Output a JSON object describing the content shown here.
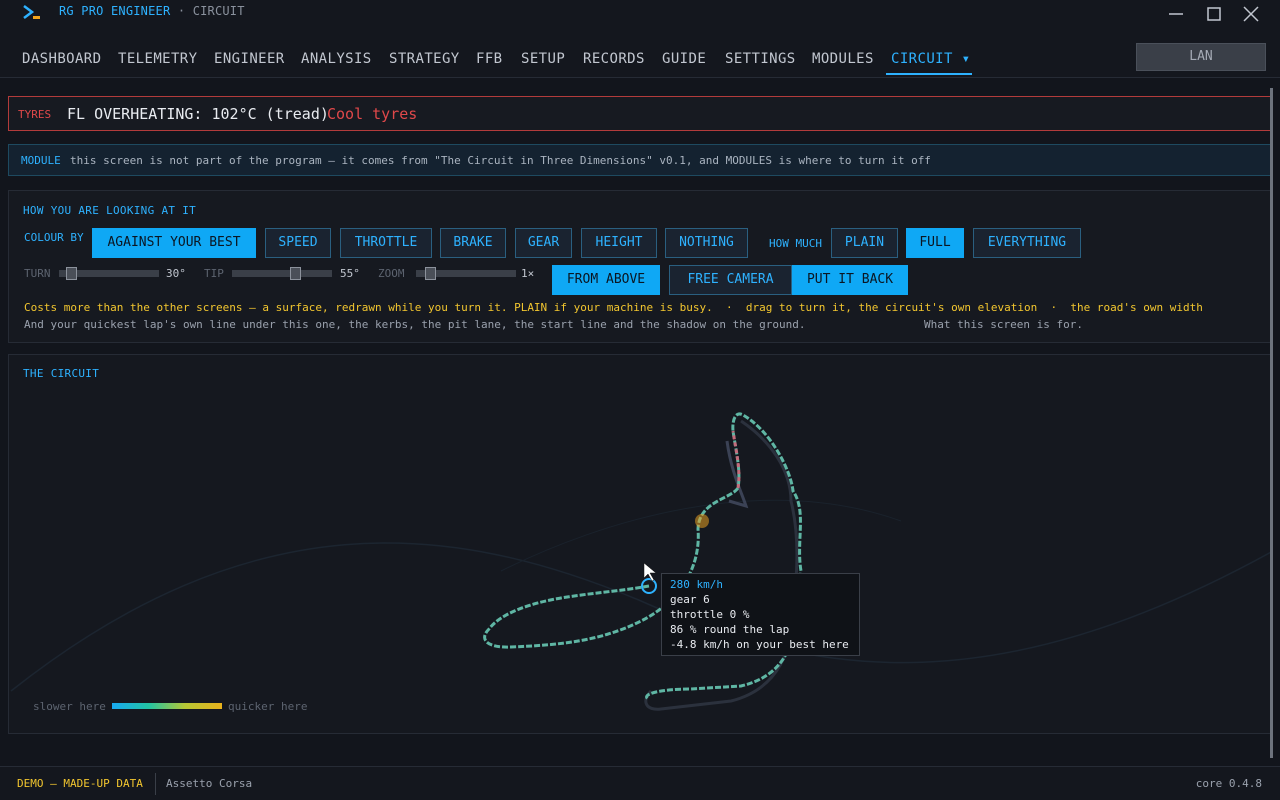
{
  "window": {
    "app_name": "RG PRO ENGINEER",
    "separator": "·",
    "screen_name": "CIRCUIT",
    "logo_icon": "terminal-prompt-icon",
    "accent": "#2eb2ff"
  },
  "nav": {
    "tabs": [
      "DASHBOARD",
      "TELEMETRY",
      "ENGINEER",
      "ANALYSIS",
      "STRATEGY",
      "FFB",
      "SETUP",
      "RECORDS",
      "GUIDE",
      "SETTINGS",
      "MODULES",
      "CIRCUIT ▾"
    ],
    "active": "CIRCUIT ▾",
    "lan_label": "LAN"
  },
  "alert": {
    "tag": "TYRES",
    "message": "FL OVERHEATING: 102°C (tread)",
    "action": "Cool tyres",
    "color": "#e0484a"
  },
  "module_banner": {
    "tag": "MODULE",
    "message": "this screen is not part of the program — it comes from \"The Circuit in Three Dimensions\" v0.1, and MODULES is where to turn it off"
  },
  "controls": {
    "title": "HOW YOU ARE LOOKING AT IT",
    "colour_by_label": "COLOUR BY",
    "colour_by": [
      "AGAINST YOUR BEST",
      "SPEED",
      "THROTTLE",
      "BRAKE",
      "GEAR",
      "HEIGHT",
      "NOTHING"
    ],
    "colour_by_selected": "AGAINST YOUR BEST",
    "how_much_label": "HOW MUCH",
    "how_much": [
      "PLAIN",
      "FULL",
      "EVERYTHING"
    ],
    "how_much_selected": "FULL",
    "turn": {
      "label": "TURN",
      "value": "30°"
    },
    "tip": {
      "label": "TIP",
      "value": "55°"
    },
    "zoom": {
      "label": "ZOOM",
      "value": "1×"
    },
    "from_above": "FROM ABOVE",
    "free_camera": "FREE CAMERA",
    "put_it_back": "PUT IT BACK",
    "note_cost": "Costs more than the other screens — a surface, redrawn while you turn it. PLAIN if your machine is busy.",
    "note_sep": "·",
    "note_drag": "drag to turn it, the circuit's own elevation",
    "note_width": "the road's own width",
    "note_more": "And your quickest lap's own line under this one, the kerbs, the pit lane, the start line and the shadow on the ground.",
    "note_purpose": "What this screen is for."
  },
  "circuit": {
    "title": "THE CIRCUIT",
    "tooltip": {
      "speed": "280 km/h",
      "gear": "gear 6",
      "throttle": "throttle 0 %",
      "lap": "86 % round the lap",
      "delta": "-4.8 km/h on your best here"
    },
    "legend_slow": "slower here",
    "legend_fast": "quicker here"
  },
  "footer": {
    "mode": "DEMO — MADE-UP DATA",
    "game": "Assetto Corsa",
    "version": "core 0.4.8"
  }
}
